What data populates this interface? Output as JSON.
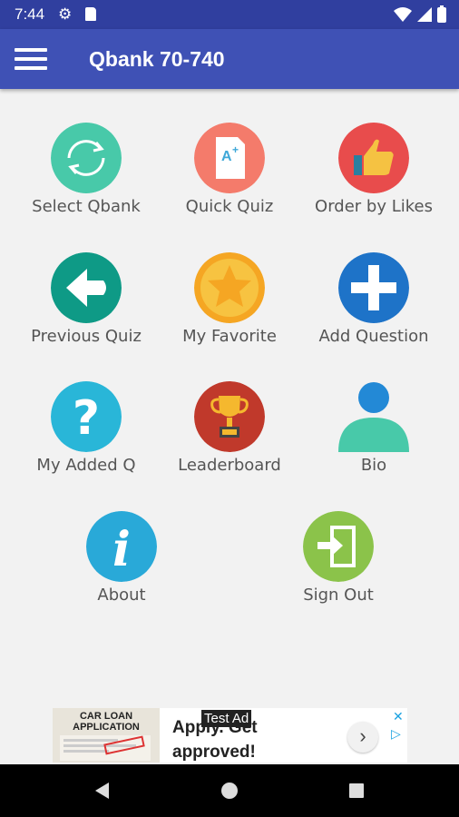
{
  "status_bar": {
    "time": "7:44",
    "icons": [
      "gear-icon",
      "sd-card-icon",
      "wifi-icon",
      "signal-icon",
      "battery-icon"
    ]
  },
  "app_bar": {
    "title": "Qbank 70-740",
    "menu_icon": "hamburger-menu-icon",
    "color": "#3f51b5"
  },
  "menu": {
    "items": [
      {
        "label": "Select Qbank",
        "icon": "sync-icon",
        "color": "#48c9a9"
      },
      {
        "label": "Quick Quiz",
        "icon": "quiz-document-icon",
        "color": "#f47b6b"
      },
      {
        "label": "Order by Likes",
        "icon": "thumbs-up-icon",
        "color": "#e84c4c"
      },
      {
        "label": "Previous Quiz",
        "icon": "arrow-left-icon",
        "color": "#0e9a86"
      },
      {
        "label": "My Favorite",
        "icon": "star-icon",
        "color": "#f5a623"
      },
      {
        "label": "Add Question",
        "icon": "plus-icon",
        "color": "#1e73c8"
      },
      {
        "label": "My Added Q",
        "icon": "question-icon",
        "color": "#29b6d8"
      },
      {
        "label": "Leaderboard",
        "icon": "trophy-icon",
        "color": "#c0392b"
      },
      {
        "label": "Bio",
        "icon": "user-icon",
        "color": "#48c9a9"
      },
      {
        "label": "About",
        "icon": "info-icon",
        "color": "#29a9d8"
      },
      {
        "label": "Sign Out",
        "icon": "sign-out-icon",
        "color": "#8bc34a"
      }
    ]
  },
  "ad": {
    "image_title": "CAR LOAN APPLICATION",
    "text_line1": "Apply. Get",
    "text_line2": "approved!",
    "test_label": "Test Ad",
    "arrow": "›"
  },
  "nav_bar": {
    "icons": [
      "back-icon",
      "home-icon",
      "recents-icon"
    ]
  }
}
